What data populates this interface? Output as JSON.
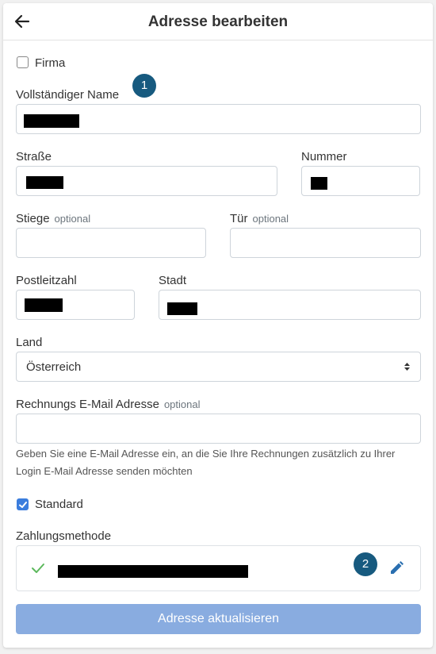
{
  "header": {
    "title": "Adresse bearbeiten"
  },
  "form": {
    "firma": {
      "label": "Firma",
      "checked": false
    },
    "full_name": {
      "label": "Vollständiger Name"
    },
    "street": {
      "label": "Straße"
    },
    "number": {
      "label": "Nummer"
    },
    "stiege": {
      "label": "Stiege",
      "optional": "optional"
    },
    "tuer": {
      "label": "Tür",
      "optional": "optional"
    },
    "zip": {
      "label": "Postleitzahl"
    },
    "city": {
      "label": "Stadt"
    },
    "country": {
      "label": "Land",
      "value": "Österreich"
    },
    "billing_email": {
      "label": "Rechnungs E-Mail Adresse",
      "optional": "optional",
      "help": "Geben Sie eine E-Mail Adresse ein, an die Sie Ihre Rechnungen zusätzlich zu Ihrer Login E-Mail Adresse senden möchten"
    },
    "standard": {
      "label": "Standard",
      "checked": true
    },
    "payment": {
      "label": "Zahlungsmethode",
      "status_icon": "check-icon",
      "edit_icon": "pencil-icon"
    },
    "submit_label": "Adresse aktualisieren"
  },
  "annotations": {
    "badge_1": "1",
    "badge_2": "2"
  },
  "colors": {
    "accent": "#3b7ddd",
    "badge": "#175a7f",
    "submit_bg": "#89ace0",
    "check": "#5cb85c"
  }
}
